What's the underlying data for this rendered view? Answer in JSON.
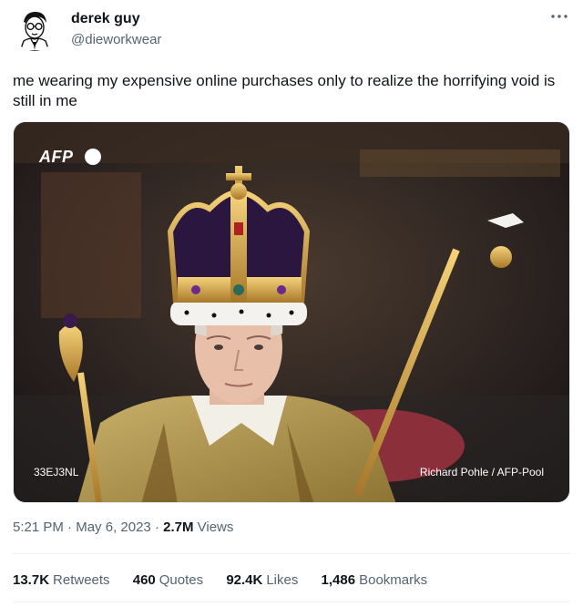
{
  "author": {
    "display_name": "derek guy",
    "handle": "@dieworkwear",
    "avatar_icon": "cartoon-portrait-avatar"
  },
  "more_icon": "more-dots-icon",
  "tweet": {
    "text": "me wearing my expensive online purchases only to realize the horrifying void is still in me"
  },
  "media": {
    "logo_text": "AFP",
    "photo_id": "33EJ3NL",
    "credit": "Richard Pohle / AFP-Pool"
  },
  "meta": {
    "time": "5:21 PM",
    "sep1": " · ",
    "date": "May 6, 2023",
    "sep2": " · ",
    "views_count": "2.7M",
    "views_label": " Views"
  },
  "stats": [
    {
      "count": "13.7K",
      "label": "Retweets"
    },
    {
      "count": "460",
      "label": "Quotes"
    },
    {
      "count": "92.4K",
      "label": "Likes"
    },
    {
      "count": "1,486",
      "label": "Bookmarks"
    }
  ],
  "colors": {
    "text": "#0f1419",
    "secondary": "#536471",
    "divider": "#eff3f4"
  }
}
